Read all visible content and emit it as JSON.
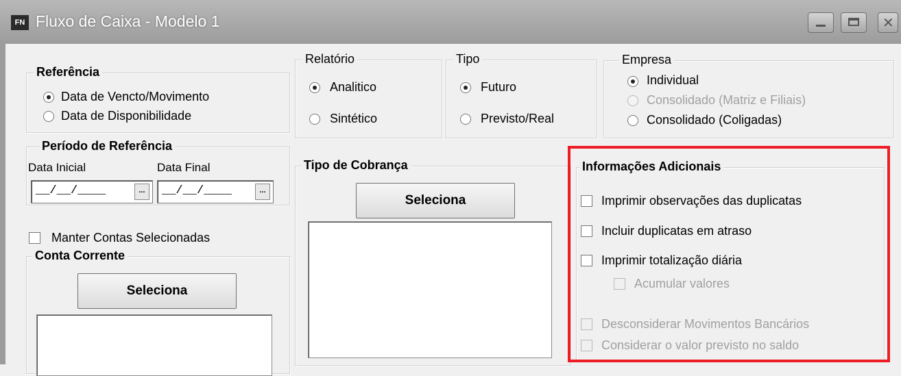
{
  "window": {
    "title": "Fluxo de Caixa - Modelo 1",
    "icon_text": "FN"
  },
  "referencia": {
    "legend": "Referência",
    "options": [
      "Data de Vencto/Movimento",
      "Data de Disponibilidade"
    ],
    "selected": "Data de Vencto/Movimento"
  },
  "periodo": {
    "legend": "Período de Referência",
    "data_inicial_label": "Data Inicial",
    "data_final_label": "Data Final",
    "data_inicial_value": "__/__/____",
    "data_final_value": "__/__/____",
    "picker_label": "..."
  },
  "manter_contas": {
    "label": "Manter Contas Selecionadas",
    "checked": false
  },
  "conta_corrente": {
    "legend": "Conta Corrente",
    "button": "Seleciona"
  },
  "relatorio": {
    "legend": "Relatório",
    "options": [
      "Analitico",
      "Sintético"
    ],
    "selected": "Analitico"
  },
  "tipo": {
    "legend": "Tipo",
    "options": [
      "Futuro",
      "Previsto/Real"
    ],
    "selected": "Futuro"
  },
  "empresa": {
    "legend": "Empresa",
    "options": [
      "Individual",
      "Consolidado (Matriz e Filiais)",
      "Consolidado (Coligadas)"
    ],
    "selected": "Individual",
    "disabled": [
      "Consolidado (Matriz e Filiais)"
    ]
  },
  "tipo_cobranca": {
    "legend": "Tipo de Cobrança",
    "button": "Seleciona"
  },
  "info_adicionais": {
    "legend": "Informações Adicionais",
    "items": [
      {
        "label": "Imprimir observações das duplicatas",
        "checked": false,
        "enabled": true
      },
      {
        "label": "Incluir duplicatas em atraso",
        "checked": false,
        "enabled": true
      },
      {
        "label": "Imprimir totalização diária",
        "checked": false,
        "enabled": true
      },
      {
        "label": "Acumular valores",
        "checked": false,
        "enabled": false
      },
      {
        "label": "Desconsiderar Movimentos Bancários",
        "checked": false,
        "enabled": false
      },
      {
        "label": "Considerar o valor previsto no saldo",
        "checked": false,
        "enabled": false
      }
    ]
  },
  "colors": {
    "highlight": "#ee1c25",
    "disabled_text": "#a0a0a0",
    "background": "#f0f0f0"
  }
}
